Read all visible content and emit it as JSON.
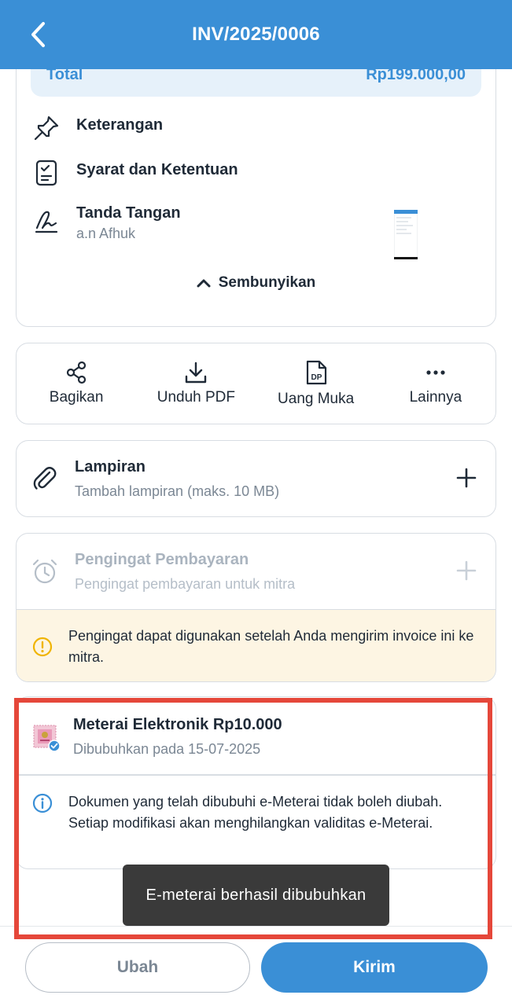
{
  "header": {
    "title": "INV/2025/0006"
  },
  "summary": {
    "total_label": "Total",
    "total_value": "Rp199.000,00"
  },
  "details": {
    "notes_label": "Keterangan",
    "terms_label": "Syarat dan Ketentuan",
    "signature_label": "Tanda Tangan",
    "signature_name": "a.n Afhuk",
    "hide_label": "Sembunyikan"
  },
  "actions": [
    {
      "label": "Bagikan",
      "icon": "share-icon"
    },
    {
      "label": "Unduh PDF",
      "icon": "download-icon"
    },
    {
      "label": "Uang Muka",
      "icon": "dp-document-icon"
    },
    {
      "label": "Lainnya",
      "icon": "more-icon"
    }
  ],
  "attachment": {
    "title": "Lampiran",
    "subtitle": "Tambah lampiran (maks. 10 MB)"
  },
  "reminder": {
    "title": "Pengingat Pembayaran",
    "subtitle": "Pengingat pembayaran untuk mitra",
    "warning": "Pengingat dapat digunakan setelah Anda mengirim invoice ini ke mitra."
  },
  "meterai": {
    "title": "Meterai Elektronik Rp10.000",
    "subtitle": "Dibubuhkan pada 15-07-2025",
    "info": "Dokumen yang telah dibubuhi e-Meterai tidak boleh diubah. Setiap modifikasi akan menghilangkan validitas e-Meterai."
  },
  "toast": {
    "message": "E-meterai berhasil dibubuhkan"
  },
  "footer": {
    "edit_label": "Ubah",
    "send_label": "Kirim"
  },
  "colors": {
    "primary": "#3a8fd6",
    "highlight": "#e5473a",
    "warning_bg": "#fdf5e3",
    "warning_icon": "#f0b400"
  }
}
